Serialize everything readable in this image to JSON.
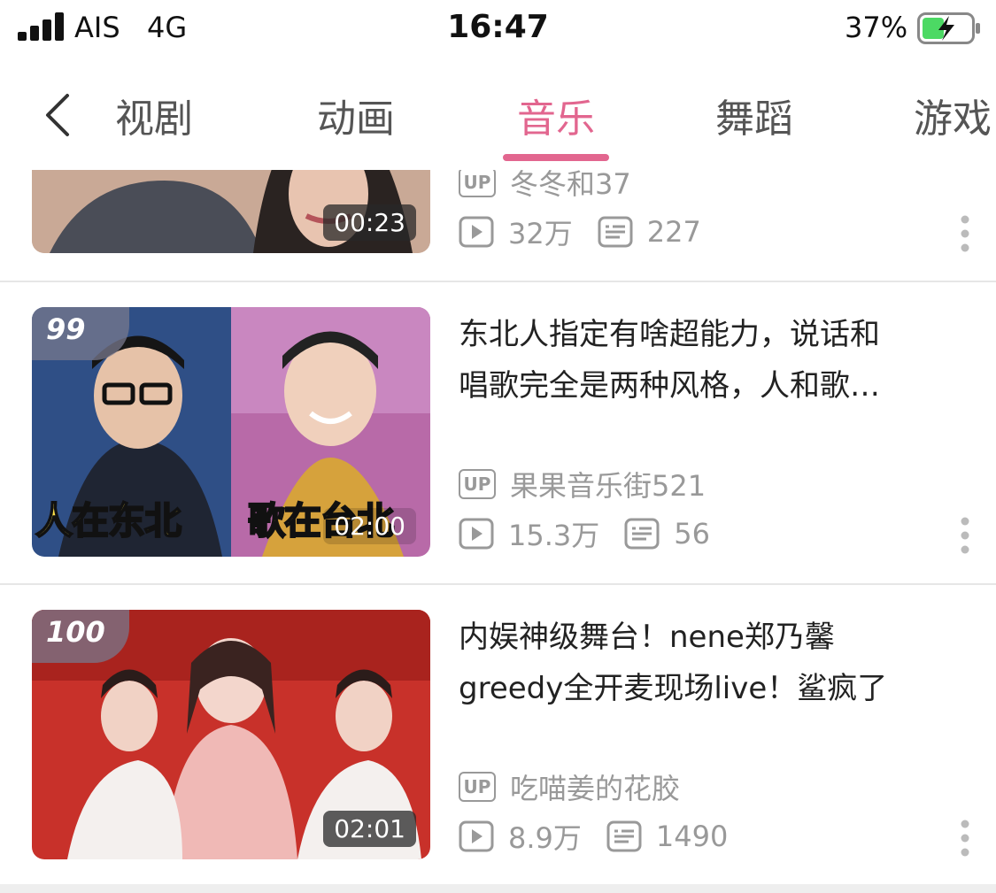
{
  "status_bar": {
    "carrier": "AIS",
    "network": "4G",
    "time": "16:47",
    "battery_percent": "37%"
  },
  "tabs": [
    {
      "label": "视剧"
    },
    {
      "label": "动画"
    },
    {
      "label": "音乐"
    },
    {
      "label": "舞蹈"
    },
    {
      "label": "游戏"
    }
  ],
  "active_tab": "音乐",
  "colors": {
    "accent": "#e2668f",
    "meta": "#999999",
    "battery": "#4cd964"
  },
  "icons": {
    "back": "chevron-left-icon",
    "plays": "play-icon",
    "danmaku": "danmaku-icon",
    "more": "more-vertical-icon",
    "up_badge": "up-badge-icon"
  },
  "videos": [
    {
      "duration": "00:23",
      "uploader_badge": "UP",
      "uploader": "冬冬和37",
      "plays": "32万",
      "danmaku": "227"
    },
    {
      "rank": "99",
      "duration": "02:00",
      "thumb_captions": [
        "人在东北",
        "歌在台北"
      ],
      "title_line1": "东北人指定有啥超能力，说话和",
      "title_line2": "唱歌完全是两种风格，人和歌…",
      "uploader_badge": "UP",
      "uploader": "果果音乐街521",
      "plays": "15.3万",
      "danmaku": "56"
    },
    {
      "rank": "100",
      "duration": "02:01",
      "title_line1": "内娱神级舞台！nene郑乃馨",
      "title_line2": "greedy全开麦现场live！鲨疯了",
      "uploader_badge": "UP",
      "uploader": "吃喵姜的花胶",
      "plays": "8.9万",
      "danmaku": "1490"
    }
  ]
}
